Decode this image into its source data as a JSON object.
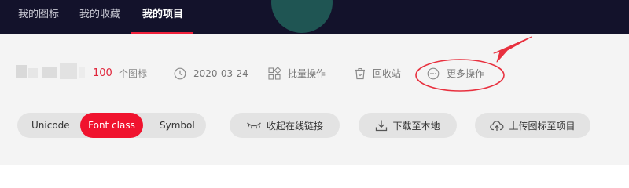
{
  "nav": {
    "tabs": [
      {
        "label": "我的图标"
      },
      {
        "label": "我的收藏"
      },
      {
        "label": "我的项目"
      }
    ]
  },
  "project": {
    "icon_count": "100",
    "icon_count_label": "个图标",
    "date": "2020-03-24",
    "batch_label": "批量操作",
    "recycle_label": "回收站",
    "more_label": "更多操作"
  },
  "format": {
    "options": [
      "Unicode",
      "Font class",
      "Symbol"
    ],
    "selected": "Font class"
  },
  "actions": {
    "online_link": "收起在线链接",
    "download": "下载至本地",
    "upload": "上传图标至项目"
  },
  "colors": {
    "accent": "#f0132e",
    "topbar": "#13122b",
    "annotation": "#e8303e"
  }
}
